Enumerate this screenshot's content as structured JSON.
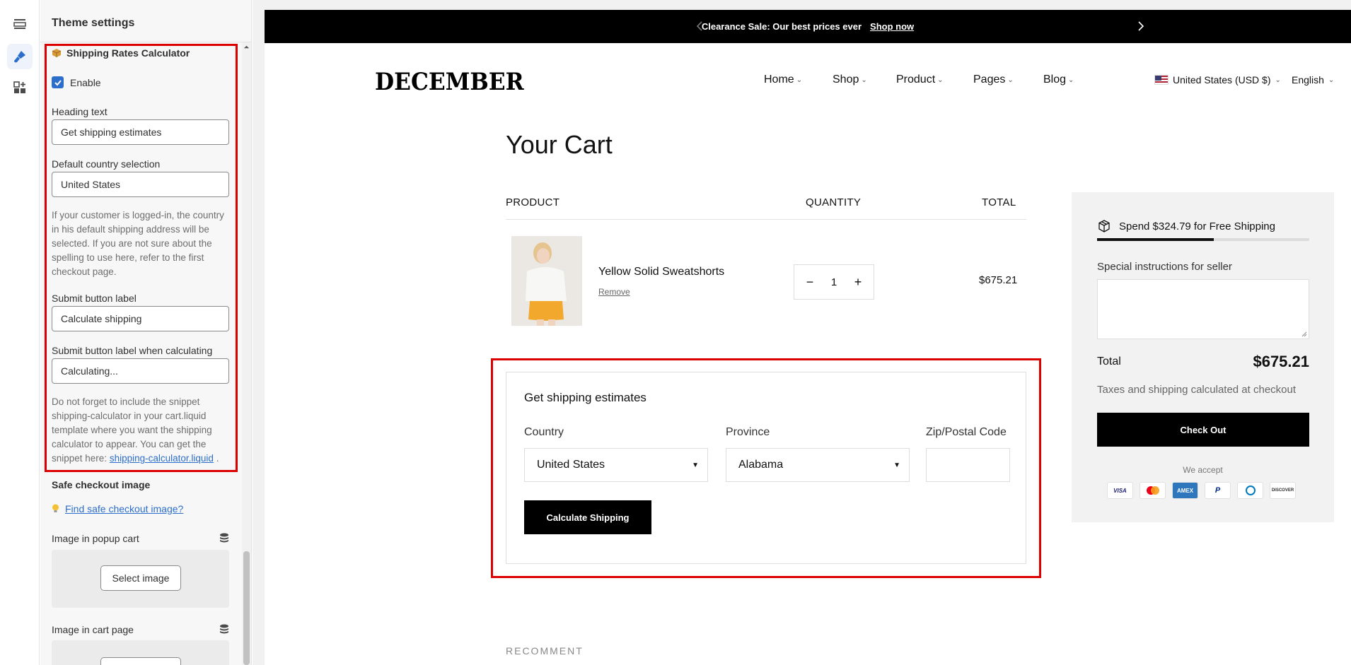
{
  "editor": {
    "panel_title": "Theme settings",
    "section_title": "Shipping Rates Calculator",
    "enable_label": "Enable",
    "heading_label": "Heading text",
    "heading_value": "Get shipping estimates",
    "country_label": "Default country selection",
    "country_value": "United States",
    "country_help": "If your customer is logged-in, the country in his default shipping address will be selected. If you are not sure about the spelling to use here, refer to the first checkout page.",
    "submit_label": "Submit button label",
    "submit_value": "Calculate shipping",
    "calculating_label": "Submit button label when calculating",
    "calculating_value": "Calculating...",
    "snippet_help": "Do not forget to include the snippet shipping-calculator in your cart.liquid template where you want the shipping calculator to appear. You can get the snippet here:",
    "snippet_link": "shipping-calculator.liquid",
    "snippet_end": ".",
    "safe_checkout_heading": "Safe checkout image",
    "find_image_link": "Find safe checkout image?",
    "popup_image_label": "Image in popup cart",
    "select_image_label": "Select image",
    "cart_image_label": "Image in cart page"
  },
  "store": {
    "announcement_text": "Clearance Sale: Our best prices ever",
    "announcement_link": "Shop now",
    "logo": "DECEMBER",
    "nav": [
      "Home",
      "Shop",
      "Product",
      "Pages",
      "Blog"
    ],
    "currency": "United States (USD $)",
    "language": "English"
  },
  "cart": {
    "title": "Your Cart",
    "col_product": "PRODUCT",
    "col_quantity": "QUANTITY",
    "col_total": "TOTAL",
    "item_name": "Yellow Solid Sweatshorts",
    "remove_label": "Remove",
    "quantity": "1",
    "line_total": "$675.21",
    "recommend_heading": "RECOMMENT"
  },
  "shipping": {
    "title": "Get shipping estimates",
    "country_label": "Country",
    "country_value": "United States",
    "province_label": "Province",
    "province_value": "Alabama",
    "zip_label": "Zip/Postal Code",
    "button": "Calculate Shipping"
  },
  "summary": {
    "free_shipping": "Spend $324.79 for Free Shipping",
    "free_shipping_progress": 0.55,
    "instructions_label": "Special instructions for seller",
    "total_label": "Total",
    "total_value": "$675.21",
    "tax_note": "Taxes and shipping calculated at checkout",
    "checkout_label": "Check Out",
    "we_accept": "We accept",
    "payment_icons": [
      "VISA",
      "MC",
      "AMEX",
      "PayPal",
      "Diners",
      "DISCOVER"
    ]
  },
  "colors": {
    "accent_blue": "#2c6ecb",
    "highlight_red": "#dd0000",
    "black": "#000000",
    "summary_bg": "#f2f2f2"
  }
}
